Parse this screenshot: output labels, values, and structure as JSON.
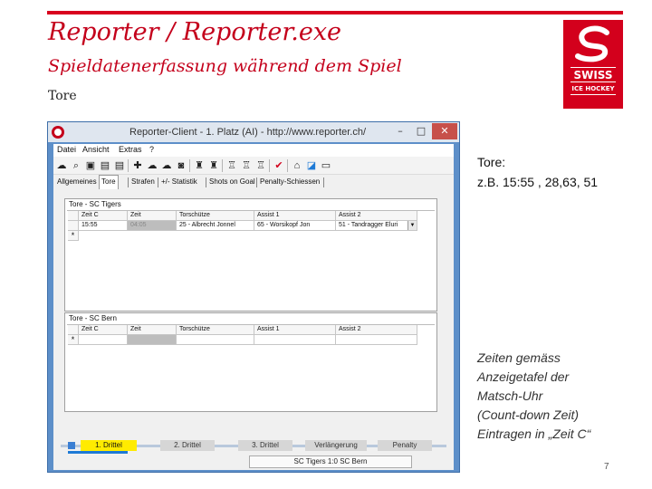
{
  "slide": {
    "title": "Reporter / Reporter.exe",
    "subtitle": "Spieldatenerfassung während dem Spiel",
    "section": "Tore",
    "page_number": "7",
    "accent_color": "#c4001b"
  },
  "logo": {
    "line1": "SWISS",
    "line2": "ICE HOCKEY"
  },
  "window": {
    "title": "Reporter-Client - 1. Platz (AI) - http://www.reporter.ch/",
    "controls": {
      "minimize": "–",
      "maximize": "□",
      "close": "✕"
    }
  },
  "menu": [
    "Datei",
    "Ansicht",
    "Extras",
    "?"
  ],
  "toolbar_icons": [
    "cloud-upload-icon",
    "search-icon",
    "save-icon",
    "clipboard-icon",
    "clipboard-icon",
    "players-icon",
    "cloud-green-icon",
    "cloud-grey-icon",
    "camera-icon",
    "team-icon",
    "team-icon",
    "lineup-icon",
    "lineup-icon",
    "lineup-icon",
    "check-icon",
    "home-icon",
    "chart-icon",
    "broadcast-icon"
  ],
  "tabs": [
    "Allgemeines",
    "Tore",
    "Strafen",
    "+/- Statistik",
    "Shots on Goal",
    "Penalty-Schiessen"
  ],
  "panel_home": {
    "title": "Tore - SC Tigers",
    "columns": [
      "Zeit C",
      "Zeit",
      "Torschütze",
      "Assist 1",
      "Assist 2"
    ],
    "rows": [
      {
        "zeit_c": "15:55",
        "zeit": "04:05",
        "torschuetze": "25 - Albrecht Jonnel",
        "assist1": "65 - Worsikopf Jon",
        "assist2": "51 - Tandragger Eluri"
      }
    ],
    "new_row_marker": "*"
  },
  "panel_away": {
    "title": "Tore - SC Bern",
    "columns": [
      "Zeit C",
      "Zeit",
      "Torschütze",
      "Assist 1",
      "Assist 2"
    ],
    "new_row_marker": "*"
  },
  "periods": [
    "1. Drittel",
    "2. Drittel",
    "3. Drittel",
    "Verlängerung",
    "Penalty"
  ],
  "active_period": "1. Drittel",
  "status": "SC Tigers 1:0 SC Bern",
  "side_note": {
    "line1": "Tore:",
    "line2": "z.B. 15:55 , 28,63, 51",
    "italic_lines": [
      "Zeiten gemäss",
      "Anzeigetafel der",
      "Matsch-Uhr",
      "(Count-down Zeit)",
      "Eintragen in „Zeit C“"
    ]
  }
}
